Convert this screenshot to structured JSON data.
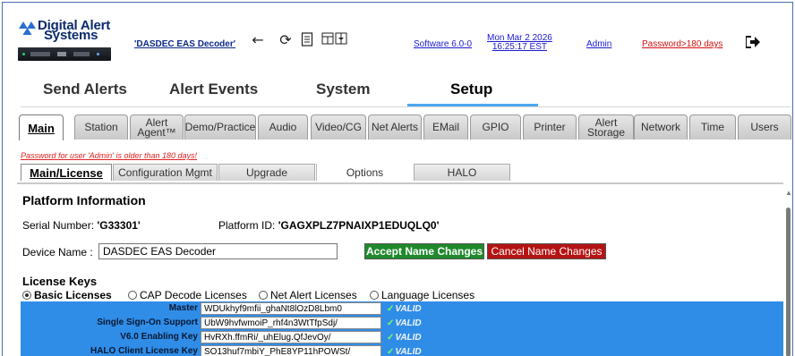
{
  "header": {
    "logo": {
      "line1": "Digital Alert",
      "line2": "Systems"
    },
    "device_name_link": "'DASDEC EAS Decoder'",
    "icons": [
      "back-arrow-icon",
      "refresh-icon",
      "document-icon",
      "split-view-icon"
    ],
    "software": "Software 6.0-0",
    "date_line1": "Mon Mar 2 2026",
    "date_line2": "16:25:17 EST",
    "user": "Admin",
    "password_status": "Password>180 days",
    "logout_icon": "logout-icon"
  },
  "main_nav": {
    "tabs": [
      {
        "label": "Send Alerts",
        "active": false
      },
      {
        "label": "Alert Events",
        "active": false
      },
      {
        "label": "System",
        "active": false
      },
      {
        "label": "Setup",
        "active": true
      }
    ],
    "accent_color": "#4ea7ef"
  },
  "sub_tabs": [
    {
      "label": "Main",
      "active": true
    },
    {
      "label": "Station"
    },
    {
      "line1": "Alert",
      "line2": "Agent™"
    },
    {
      "label": "Demo/Practice"
    },
    {
      "label": "Audio"
    },
    {
      "label": "Video/CG"
    },
    {
      "label": "Net Alerts"
    },
    {
      "label": "EMail"
    },
    {
      "label": "GPIO"
    },
    {
      "label": "Printer"
    },
    {
      "line1": "Alert",
      "line2": "Storage"
    },
    {
      "label": "Network"
    },
    {
      "label": "Time"
    },
    {
      "label": "Users"
    }
  ],
  "warning": "Password for user 'Admin' is older than 180 days!",
  "sub_tabs2": [
    {
      "label": "Main/License",
      "active": true
    },
    {
      "label": "Configuration Mgmt"
    },
    {
      "label": "Upgrade"
    },
    {
      "label": "Options"
    },
    {
      "label": "HALO"
    }
  ],
  "platform": {
    "title": "Platform Information",
    "serial_label": "Serial Number:",
    "serial_value": "'G33301'",
    "platform_id_label": "Platform ID:",
    "platform_id_value": "'GAGXPLZ7PNAIXP1EDUQLQ0'",
    "device_name_label": "Device Name :",
    "device_name_value": "DASDEC EAS Decoder",
    "accept_button": "Accept Name Changes",
    "cancel_button": "Cancel Name Changes"
  },
  "license": {
    "title": "License Keys",
    "options": [
      {
        "label": "Basic Licenses",
        "selected": true
      },
      {
        "label": "CAP Decode Licenses",
        "selected": false
      },
      {
        "label": "Net Alert Licenses",
        "selected": false
      },
      {
        "label": "Language Licenses",
        "selected": false
      }
    ],
    "keys": [
      {
        "label": "Master",
        "value": "WDUkhyf9mfii_ghaNt8lOzD8Lbm0",
        "status": "VALID"
      },
      {
        "label": "Single Sign-On Support",
        "value": "UbW9hvfwmoiP_rhf4n3WtTfpSdj/",
        "status": "VALID"
      },
      {
        "label": "V6.0 Enabling Key",
        "value": "HvRXh.ffmRi/_uhElug.QfJevOy/",
        "status": "VALID"
      },
      {
        "label": "HALO Client License Key",
        "value": "SO13huf7mbiY_PhE8YP11hPOWSt/",
        "status": "VALID"
      }
    ],
    "box_color": "#2f8de8",
    "valid_color": "#7dff5a"
  }
}
